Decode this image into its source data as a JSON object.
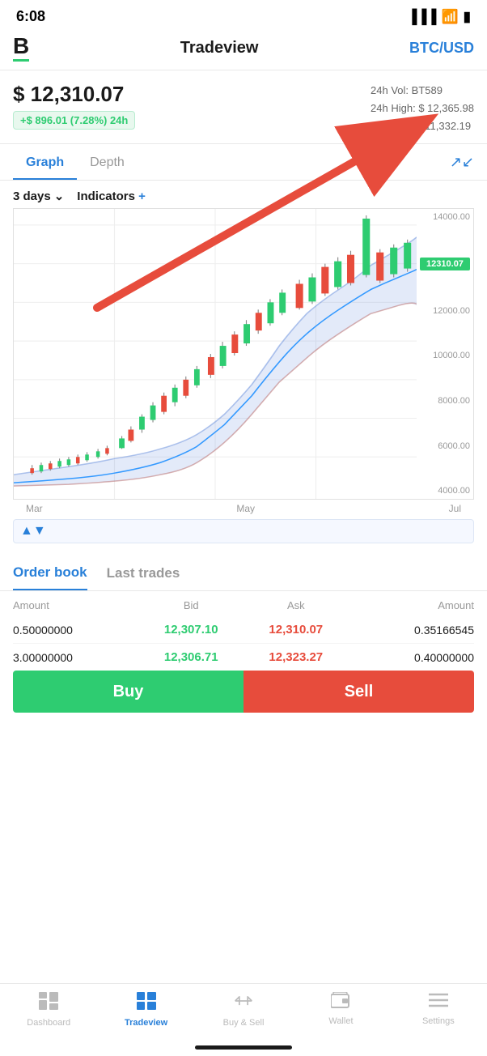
{
  "status_bar": {
    "time": "6:08",
    "location_icon": "▶",
    "battery": "🔋"
  },
  "header": {
    "logo": "B",
    "title": "Tradeview",
    "pair": "BTC/USD"
  },
  "price": {
    "main": "$ 12,310.07",
    "change": "+$ 896.01 (7.28%) 24h",
    "vol_label": "24h Vol: BT",
    "vol_value": "589",
    "high_label": "24h High:",
    "high_value": "$ 12,365.98",
    "low_label": "24h Low:",
    "low_value": "$ 11,332.19"
  },
  "tabs": {
    "graph": "Graph",
    "depth": "Depth"
  },
  "chart": {
    "days": "3 days",
    "indicators": "Indicators",
    "y_labels": [
      "14000.00",
      "12000.00",
      "10000.00",
      "8000.00",
      "6000.00",
      "4000.00"
    ],
    "price_badge": "12310.07",
    "x_labels": [
      "Mar",
      "May",
      "Jul"
    ]
  },
  "order_book": {
    "tab1": "Order book",
    "tab2": "Last trades",
    "headers": {
      "amount": "Amount",
      "bid": "Bid",
      "ask": "Ask",
      "amount_right": "Amount"
    },
    "rows": [
      {
        "amount_left": "0.50000000",
        "bid": "12,307.10",
        "ask": "12,310.07",
        "amount_right": "0.35166545"
      },
      {
        "amount_left": "3.00000000",
        "bid": "12,306.71",
        "ask": "12,323.27",
        "amount_right": "0.40000000"
      }
    ],
    "buy_label": "Buy",
    "sell_label": "Sell"
  },
  "nav": {
    "items": [
      {
        "icon": "📊",
        "label": "Dashboard",
        "active": false
      },
      {
        "icon": "⊞",
        "label": "Tradeview",
        "active": true
      },
      {
        "icon": "⇄",
        "label": "Buy & Sell",
        "active": false
      },
      {
        "icon": "👛",
        "label": "Wallet",
        "active": false
      },
      {
        "icon": "☰",
        "label": "Settings",
        "active": false
      }
    ]
  }
}
